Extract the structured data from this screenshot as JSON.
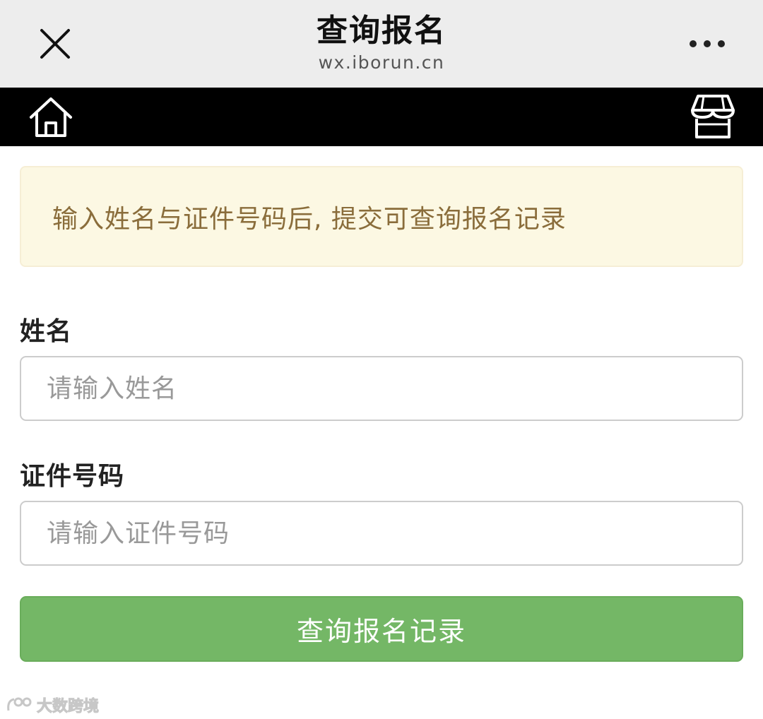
{
  "window": {
    "title": "查询报名",
    "domain": "wx.iborun.cn",
    "close_icon": "close-icon",
    "more_icon": "more-horizontal-icon"
  },
  "navbar": {
    "home_icon": "home-icon",
    "store_icon": "store-icon"
  },
  "notice": {
    "text": "输入姓名与证件号码后, 提交可查询报名记录",
    "background": "#fcf8e3",
    "text_color": "#8a6d3b"
  },
  "form": {
    "name_label": "姓名",
    "name_placeholder": "请输入姓名",
    "name_value": "",
    "id_label": "证件号码",
    "id_placeholder": "请输入证件号码",
    "id_value": "",
    "submit_label": "查询报名记录",
    "submit_color": "#74b766"
  },
  "watermark": {
    "text": "大数跨境",
    "logo_icon": "watermark-logo-icon"
  }
}
